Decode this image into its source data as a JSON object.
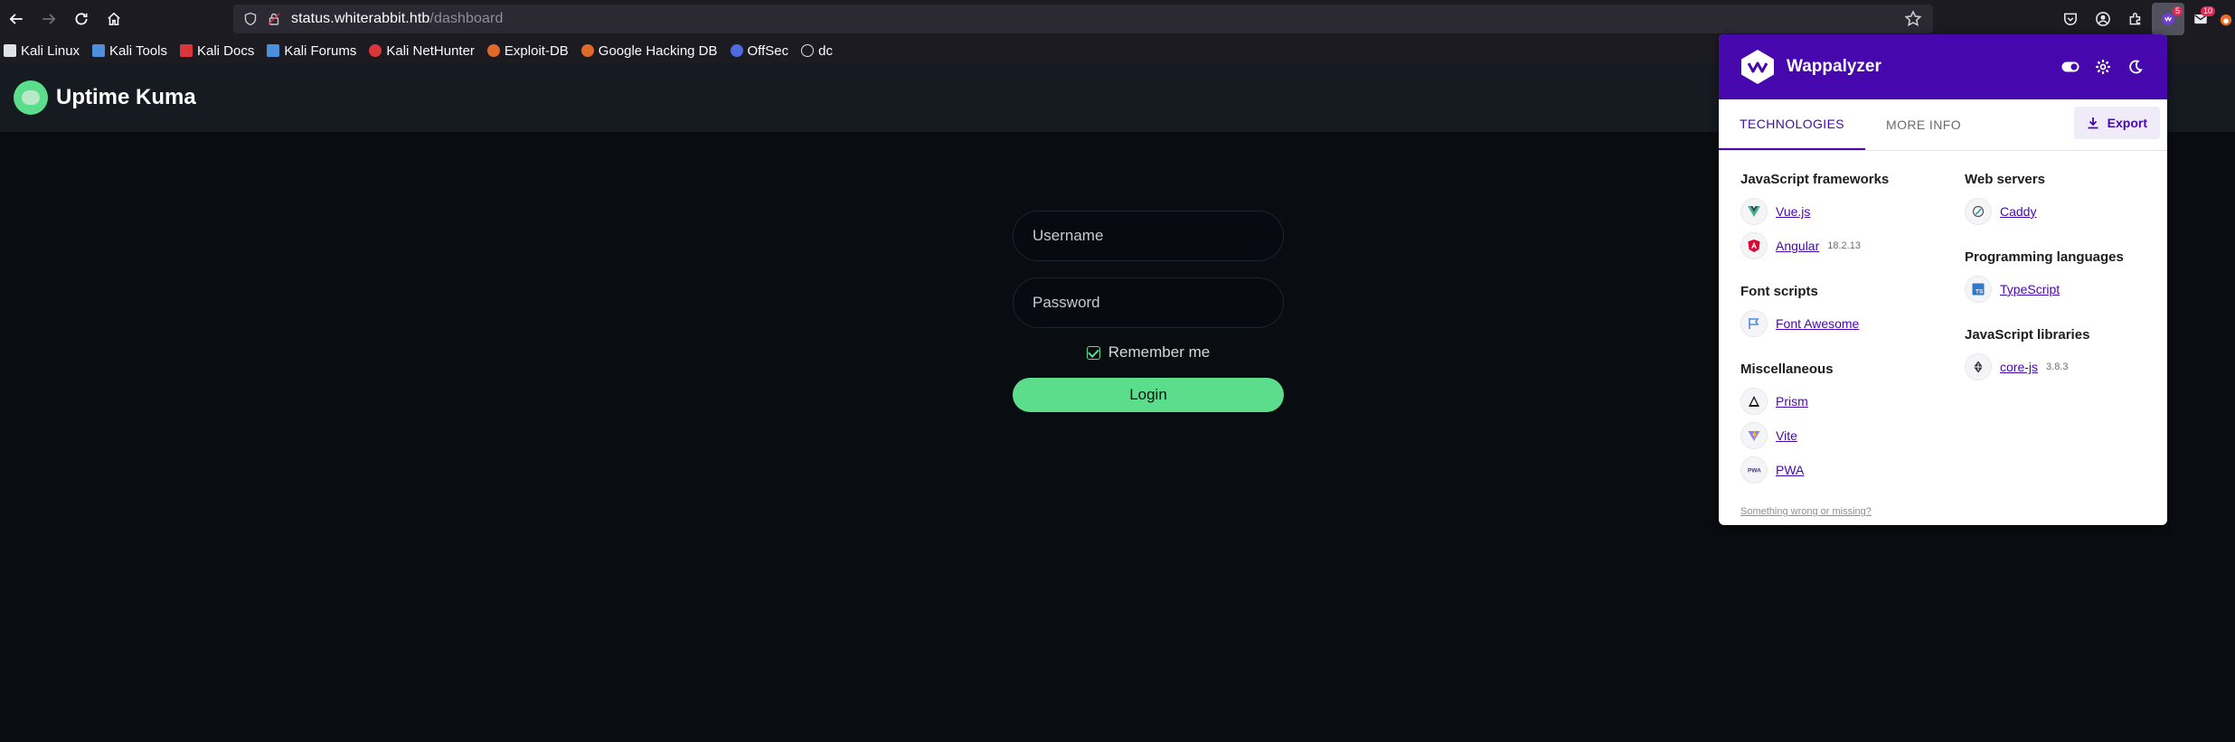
{
  "browser": {
    "url_host": "status.whiterabbit.htb",
    "url_path": "/dashboard",
    "extensions": {
      "wappalyzer_badge": "5",
      "other_badge": "10"
    }
  },
  "bookmarks": [
    {
      "label": "Kali Linux",
      "icon": "kali-dragon-icon",
      "color": "#dfe3e8"
    },
    {
      "label": "Kali Tools",
      "icon": "kali-tools-icon",
      "color": "#4d8fdc"
    },
    {
      "label": "Kali Docs",
      "icon": "kali-docs-icon",
      "color": "#d9363c"
    },
    {
      "label": "Kali Forums",
      "icon": "kali-forums-icon",
      "color": "#4d8fdc"
    },
    {
      "label": "Kali NetHunter",
      "icon": "nethunter-icon",
      "color": "#d9363c"
    },
    {
      "label": "Exploit-DB",
      "icon": "exploit-db-icon",
      "color": "#e06a2a"
    },
    {
      "label": "Google Hacking DB",
      "icon": "ghdb-icon",
      "color": "#e06a2a"
    },
    {
      "label": "OffSec",
      "icon": "offsec-icon",
      "color": "#4d6bdc"
    },
    {
      "label": "dc",
      "icon": "globe-icon",
      "color": "#dfe3e8"
    }
  ],
  "app": {
    "title": "Uptime Kuma",
    "accent": "#5cdd8b"
  },
  "login": {
    "username_placeholder": "Username",
    "password_placeholder": "Password",
    "remember_label": "Remember me",
    "remember_checked": true,
    "submit_label": "Login"
  },
  "wappalyzer": {
    "title": "Wappalyzer",
    "brand_color": "#4608ad",
    "tabs": [
      "TECHNOLOGIES",
      "MORE INFO"
    ],
    "active_tab": "TECHNOLOGIES",
    "export_label": "Export",
    "left_categories": [
      {
        "title": "JavaScript frameworks",
        "items": [
          {
            "name": "Vue.js",
            "version": "",
            "icon": "vue-icon"
          },
          {
            "name": "Angular",
            "version": "18.2.13",
            "icon": "angular-icon"
          }
        ]
      },
      {
        "title": "Font scripts",
        "items": [
          {
            "name": "Font Awesome",
            "version": "",
            "icon": "font-awesome-icon"
          }
        ]
      },
      {
        "title": "Miscellaneous",
        "items": [
          {
            "name": "Prism",
            "version": "",
            "icon": "prism-icon"
          },
          {
            "name": "Vite",
            "version": "",
            "icon": "vite-icon"
          },
          {
            "name": "PWA",
            "version": "",
            "icon": "pwa-icon"
          }
        ]
      }
    ],
    "right_categories": [
      {
        "title": "Web servers",
        "items": [
          {
            "name": "Caddy",
            "version": "",
            "icon": "caddy-icon"
          }
        ]
      },
      {
        "title": "Programming languages",
        "items": [
          {
            "name": "TypeScript",
            "version": "",
            "icon": "typescript-icon"
          }
        ]
      },
      {
        "title": "JavaScript libraries",
        "items": [
          {
            "name": "core-js",
            "version": "3.8.3",
            "icon": "core-js-icon"
          }
        ]
      }
    ],
    "footer_link": "Something wrong or missing?"
  }
}
